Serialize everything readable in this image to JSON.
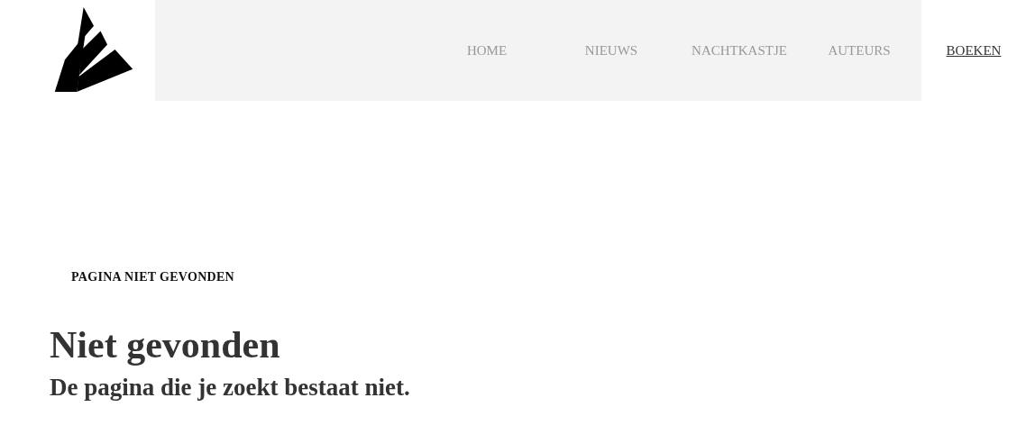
{
  "nav": [
    {
      "label": "HOME",
      "selected": false
    },
    {
      "label": "NIEUWS",
      "selected": false
    },
    {
      "label": "NACHTKASTJE",
      "selected": false
    },
    {
      "label": "AUTEURS",
      "selected": false
    },
    {
      "label": "BOEKEN",
      "selected": true
    }
  ],
  "breadcrumb": "PAGINA NIET GEVONDEN",
  "heading": "Niet gevonden",
  "subheading": "De pagina die je zoekt bestaat niet."
}
